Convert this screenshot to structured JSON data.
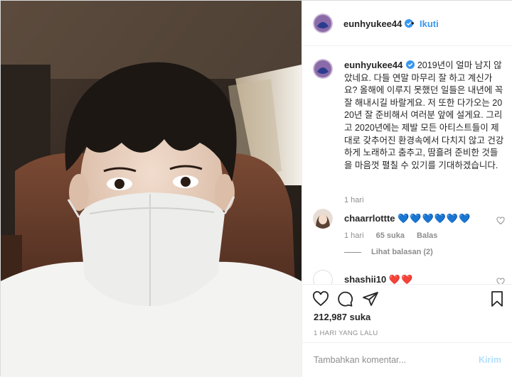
{
  "post": {
    "username": "eunhyukee44",
    "follow_label": "Ikuti",
    "separator": "•",
    "caption": "2019년이 얼마 남지 않았네요. 다들 연말 마무리 잘 하고 계신가요? 올해에 이루지 못했던 일들은 내년에 꼭 잘 해내시길 바랄게요. 저 또한 다가오는 2020년 잘 준비해서 여러분 앞에 설게요. 그리고 2020년에는 제발 모든 아티스트들이 제대로 갖추어진 환경속에서 다치지 않고 건강하게 노래하고 춤추고, 땀흘려 준비한 것들을 마음껏 펼칠 수 있기를 기대하겠습니다.",
    "caption_time": "1 hari",
    "likes": "212,987 suka",
    "date": "1 HARI YANG LALU"
  },
  "comments": [
    {
      "username": "chaarrlottte",
      "text": "💙💙💙💙💙💙",
      "time": "1 hari",
      "likes": "65 suka",
      "reply_label": "Balas",
      "view_replies": "Lihat balasan (2)"
    },
    {
      "username": "shashii10",
      "text": "❤️❤️"
    }
  ],
  "composer": {
    "placeholder": "Tambahkan komentar...",
    "post_label": "Kirim"
  },
  "icons": {
    "verified": "verified-badge-icon",
    "like": "heart-icon",
    "comment": "comment-icon",
    "share": "paper-plane-icon",
    "save": "bookmark-icon"
  },
  "colors": {
    "accent": "#3897f0",
    "verified": "#3897f0",
    "muted": "#8e8e8e",
    "post_disabled": "#b2dffc",
    "heart_blue": "#1a73e8",
    "heart_red": "#e0245e"
  }
}
